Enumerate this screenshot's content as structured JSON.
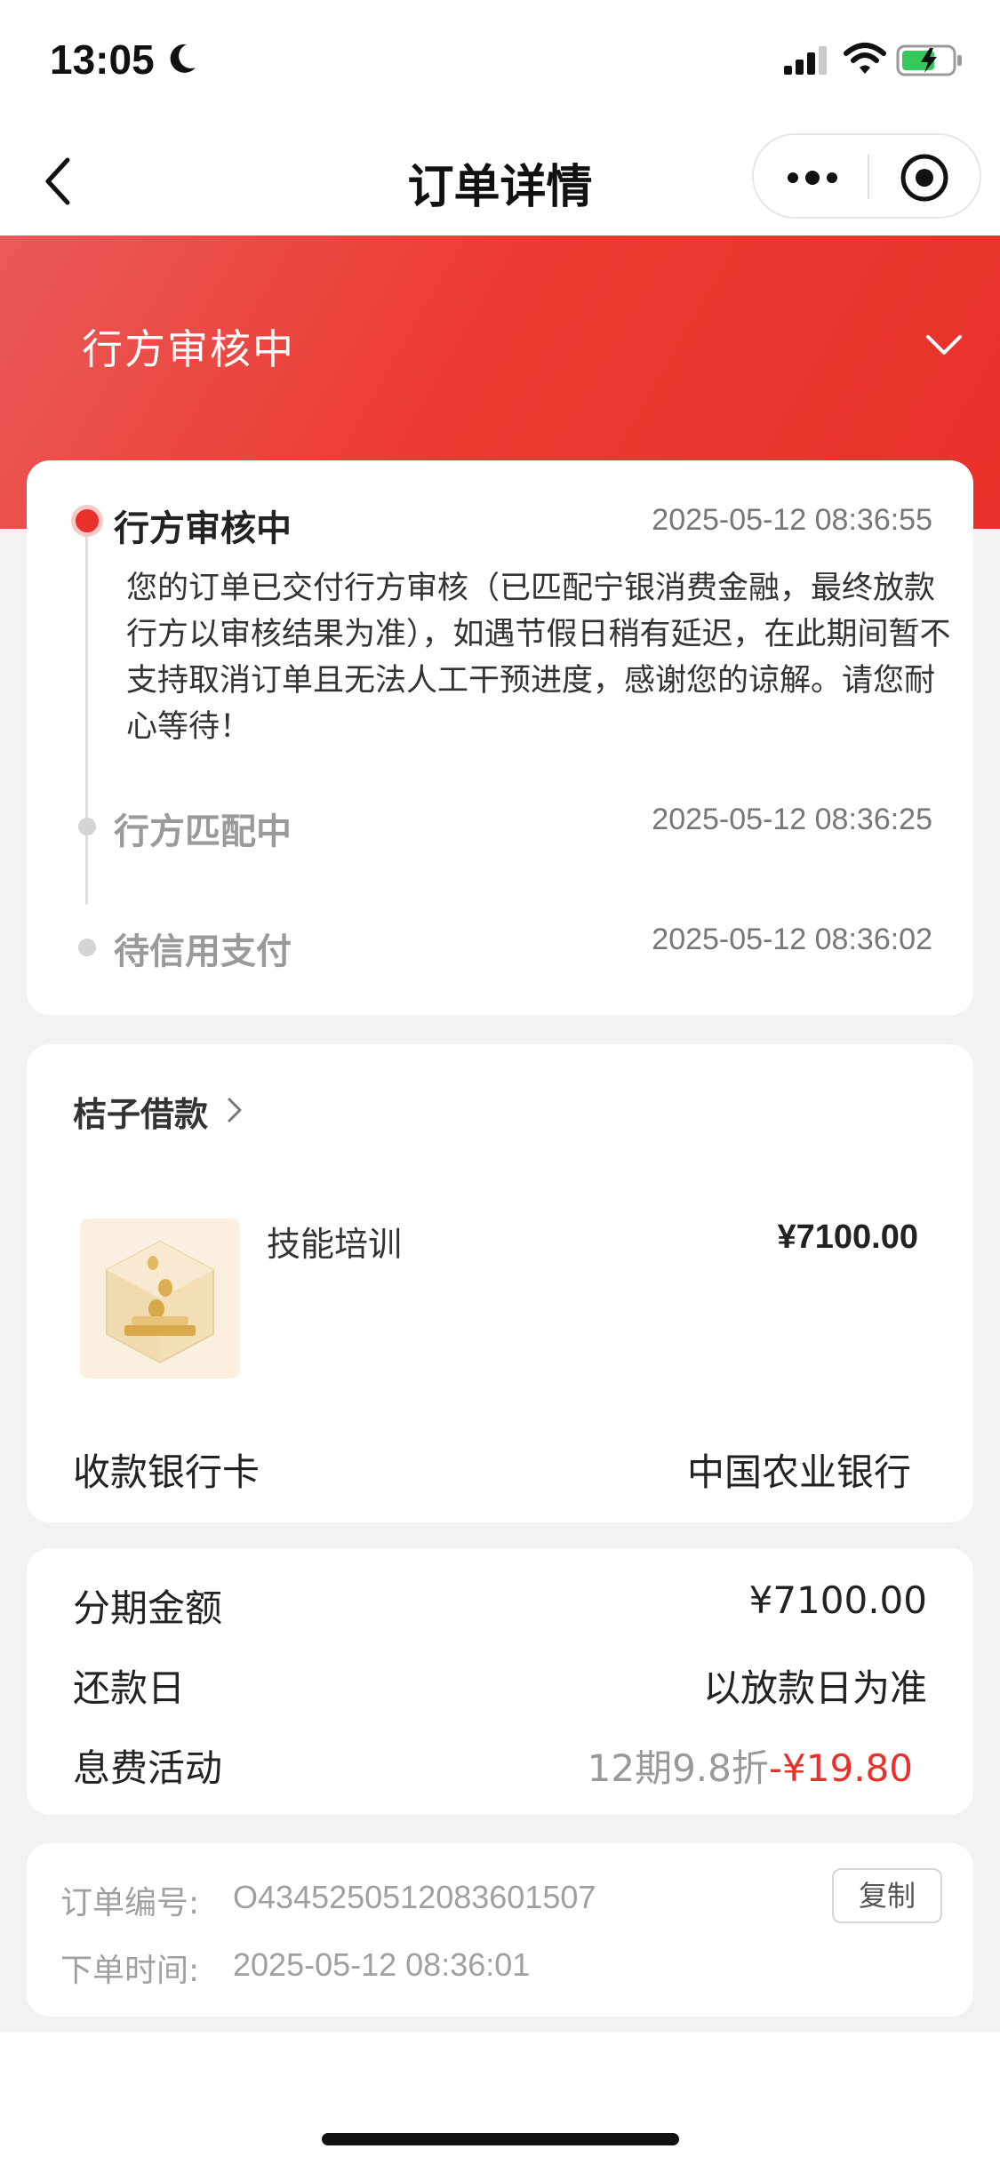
{
  "status_bar": {
    "time": "13:05",
    "icons": [
      "moon-icon",
      "signal-icon",
      "wifi-icon",
      "battery-charging-icon"
    ]
  },
  "nav": {
    "title": "订单详情",
    "back_icon": "chevron-left-icon",
    "more_icon": "more-dots-icon",
    "close_icon": "target-icon"
  },
  "header": {
    "status_title": "行方审核中",
    "expand_icon": "chevron-down-icon",
    "colors": {
      "gradient_start": "#ea5a57",
      "gradient_end": "#e8312a"
    }
  },
  "timeline": [
    {
      "title": "行方审核中",
      "time": "2025-05-12 08:36:55",
      "active": true,
      "description": "您的订单已交付行方审核（已匹配宁银消费金融，最终放款行方以审核结果为准），如遇节假日稍有延迟，在此期间暂不支持取消订单且无法人工干预进度，感谢您的谅解。请您耐心等待！"
    },
    {
      "title": "行方匹配中",
      "time": "2025-05-12 08:36:25",
      "active": false
    },
    {
      "title": "待信用支付",
      "time": "2025-05-12 08:36:02",
      "active": false
    }
  ],
  "product_card": {
    "merchant": "桔子借款",
    "product_name": "技能培训",
    "price": "¥7100.00",
    "bank_label": "收款银行卡",
    "bank_value": "中国农业银行"
  },
  "installment": {
    "amount_label": "分期金额",
    "amount_value": "¥7100.00",
    "repay_label": "还款日",
    "repay_value": "以放款日为准",
    "fee_label": "息费活动",
    "fee_note": "12期9.8折",
    "fee_discount": "-¥19.80"
  },
  "order": {
    "number_label": "订单编号:",
    "number_value": "O4345250512083601507",
    "time_label": "下单时间:",
    "time_value": "2025-05-12 08:36:01",
    "copy_label": "复制"
  },
  "colors": {
    "accent_red": "#e9302a",
    "page_bg": "#f2f2f2"
  }
}
